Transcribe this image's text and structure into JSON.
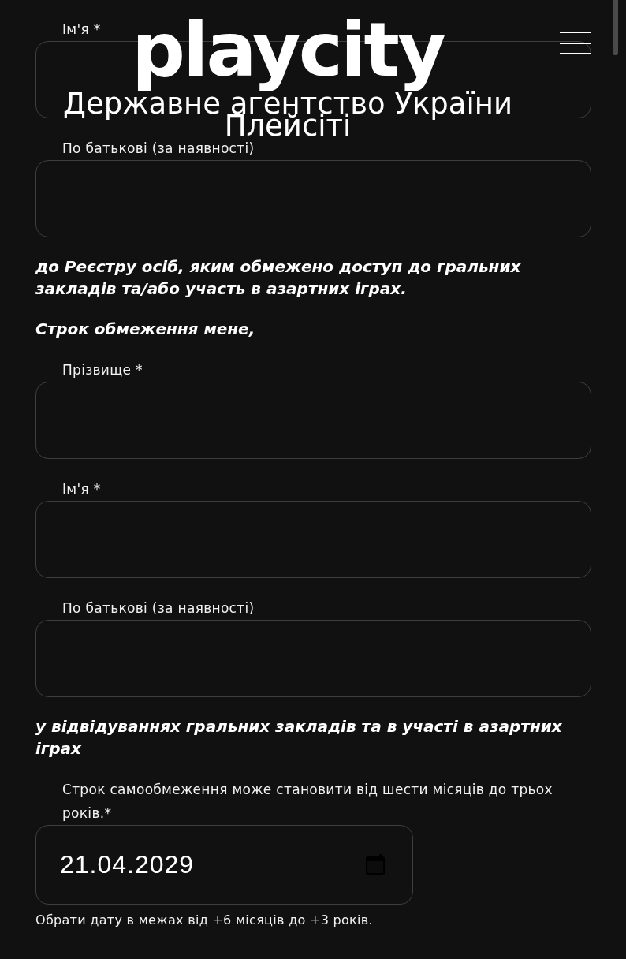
{
  "header": {
    "logo": "playcity",
    "title": "Державне агентство України Плейсіті"
  },
  "blocks": [
    {
      "kind": "field",
      "label": "Ім'я *"
    },
    {
      "kind": "field",
      "label": "По батькові (за наявності)"
    },
    {
      "kind": "note",
      "text": "до Реєстру осіб, яким обмежено доступ до гральних закладів та/або участь в азартних іграх."
    },
    {
      "kind": "note",
      "text": "Строк обмеження мене,"
    },
    {
      "kind": "field",
      "label": "Прізвище *"
    },
    {
      "kind": "field",
      "label": "Ім'я *"
    },
    {
      "kind": "field",
      "label": "По батькові (за наявності)"
    },
    {
      "kind": "note",
      "text": "у відвідуваннях гральних закладів та в участі в азартних іграх"
    },
    {
      "kind": "date_field",
      "label": "Строк самообмеження може становити від шести місяців до трьох років.*",
      "value": "21.04.2029",
      "hint": "Обрати дату в межах від +6 місяців до +3 років."
    }
  ]
}
